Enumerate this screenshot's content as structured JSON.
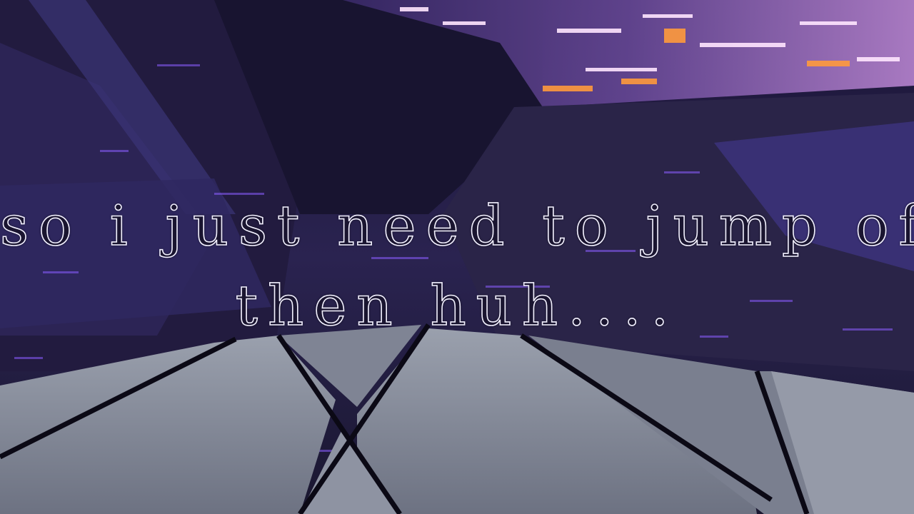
{
  "dialogue": {
    "line1": "so i just need to jump off",
    "line2": "then huh...."
  },
  "colors": {
    "sky": "#12102a",
    "rooftop": "#8a8f9e",
    "city_glow": "#c9a0ff",
    "street_lights": "#ff9a3c",
    "glitch": "#8a5cff",
    "subtitle_outline": "#f2f0ff"
  }
}
